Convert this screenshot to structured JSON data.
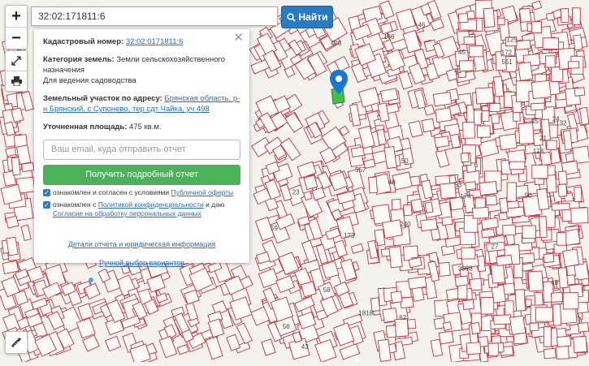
{
  "search": {
    "value": "32:02:171811:6"
  },
  "find_label": "Найти",
  "zoom": {
    "in": "+",
    "out": "−"
  },
  "icons": [
    "search-icon",
    "expand-icon",
    "print-icon",
    "ruler-icon",
    "map-pin-icon"
  ],
  "colors": {
    "parcel_line": "#c0333c",
    "accent": "#2b7bc2",
    "button_green": "#4bb25a",
    "selected_parcel": "#3fc04a",
    "pin": "#1976d2"
  },
  "panel": {
    "cad_label": "Кадастровый номер:",
    "cad_value": "32:02:0171811:6",
    "cat_label": "Категория земель:",
    "cat_value": "Земли сельскохозяйственного назначения",
    "use_value": "Для ведения садоводства",
    "addr_label": "Земельный участок по адресу:",
    "addr_value": "Брянская область, р-н Брянский, с Супонево, тер сдт Чайка, уч 498",
    "area_label": "Уточненная площадь:",
    "area_value": "475 кв.м.",
    "email_placeholder": "Ваш email, куда отправить отчет",
    "get_report": "Получить подробный отчет",
    "agree1_text": "ознакомлен и согласен с условиями",
    "agree1_link": "Публичной оферты",
    "agree2_text": "ознакомлен с",
    "agree2_link": "Политикой конфиденциальности",
    "agree2_tail": "и даю",
    "agree2_link2": "Согласие на обработку персональных данных",
    "details_link": "Детали отчета и юридическая информация",
    "manual_link": "Ручной выбор вариантов"
  },
  "map_labels": [
    "125",
    "132",
    "1818",
    "3098",
    "498",
    "45",
    "43",
    "41",
    "53",
    "45",
    "62",
    "49",
    "50",
    "59",
    "23",
    "24",
    "27",
    "46",
    "166",
    "178",
    "240",
    "239",
    "172",
    "173",
    "174",
    "551",
    "557",
    "56",
    "58",
    "21",
    "90",
    "48"
  ]
}
